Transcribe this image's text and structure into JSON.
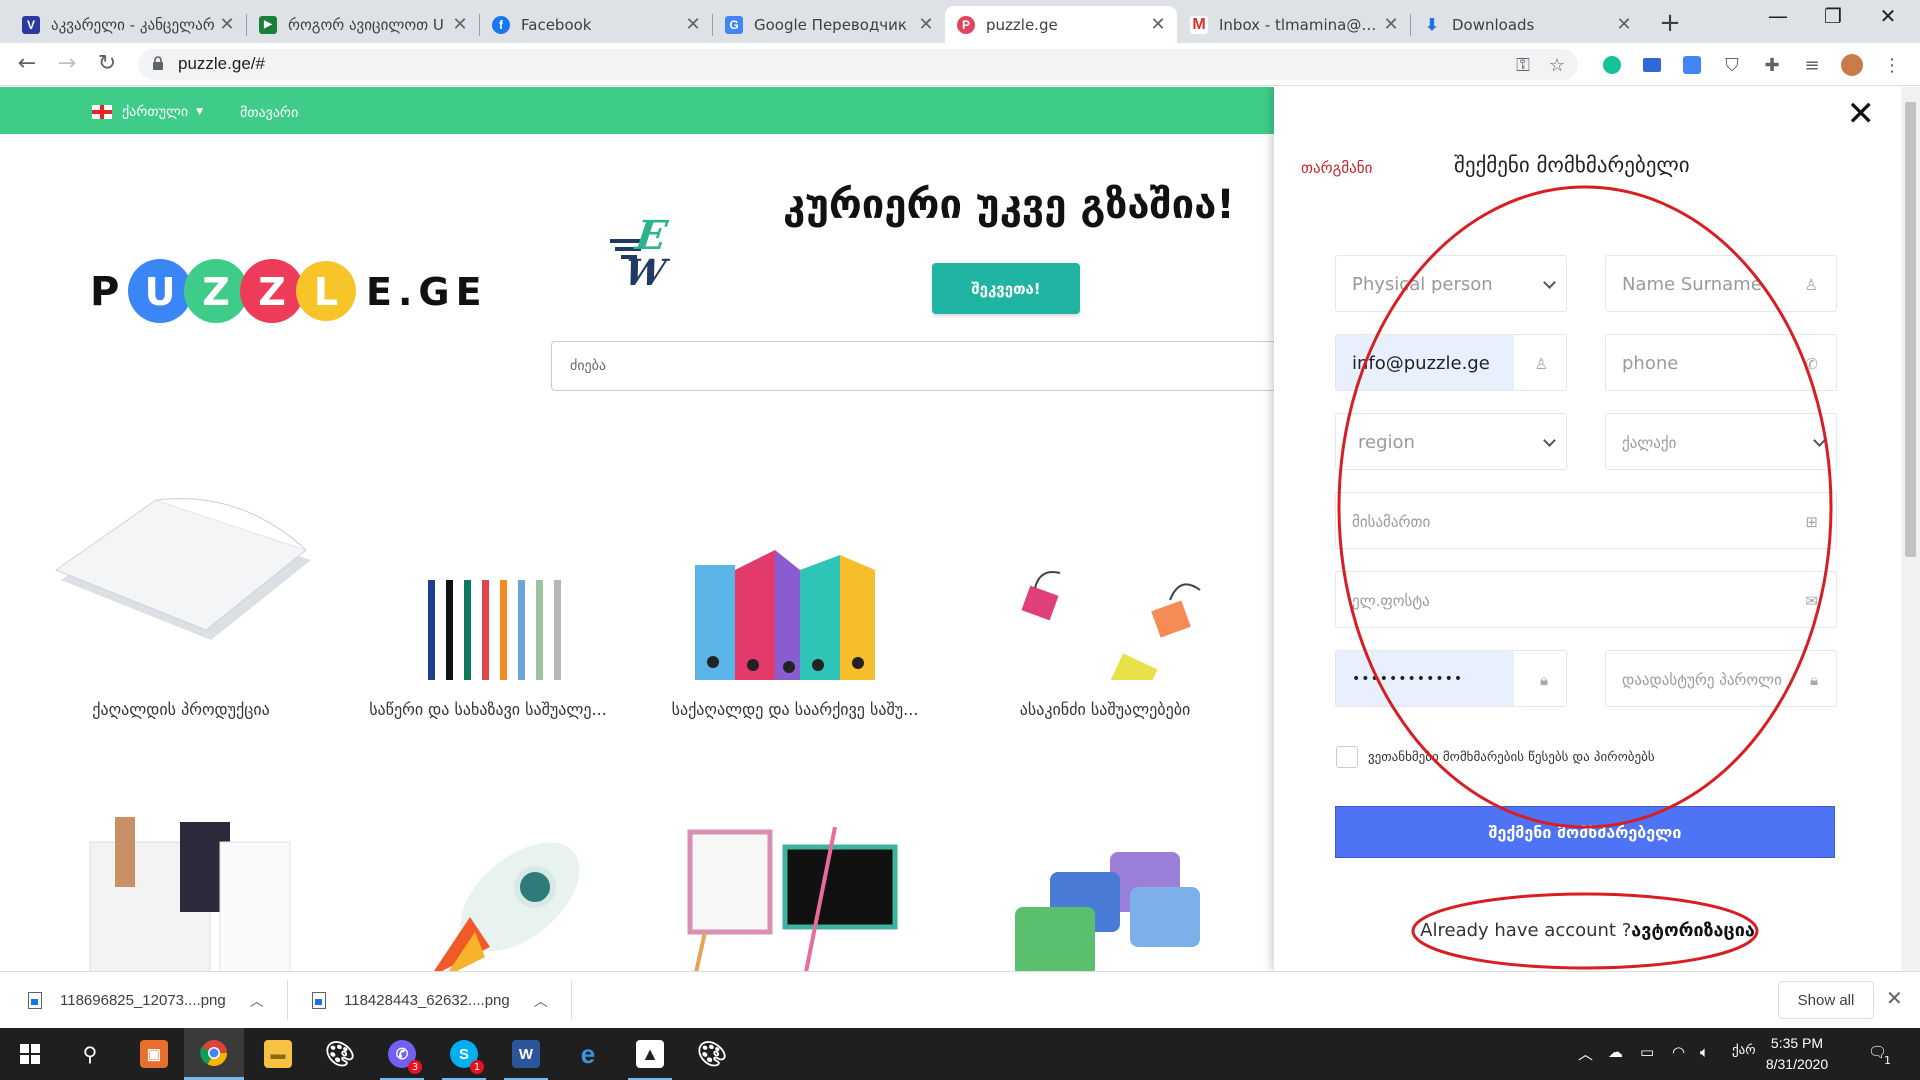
{
  "browser": {
    "tabs": [
      {
        "title": "აკვარელი - კანცელარ",
        "favicon": "V",
        "color": "#2b3aa0"
      },
      {
        "title": "როგორ ავიცილოთ U",
        "favicon": "▶",
        "color": "#188038"
      },
      {
        "title": "Facebook",
        "favicon": "f",
        "color": "#1877f2"
      },
      {
        "title": "Google Переводчик",
        "favicon": "G",
        "color": "#4285f4"
      },
      {
        "title": "puzzle.ge",
        "favicon": "P",
        "color": "#e2445c"
      },
      {
        "title": "Inbox - tlmamina@gm",
        "favicon": "M",
        "color": "#d93025"
      },
      {
        "title": "Downloads",
        "favicon": "⬇",
        "color": "#1a73e8"
      }
    ],
    "active_tab": 4,
    "url": "puzzle.ge/#"
  },
  "site": {
    "lang_label": "ქართული",
    "menu_home": "მთავარი",
    "logo_text_left": "P",
    "logo_letters": [
      "U",
      "Z",
      "Z",
      "L"
    ],
    "logo_text_right": "E.GE",
    "banner_brand": "Easy Way",
    "banner_title": "კურიერი უკვე გზაშია!",
    "banner_button": "შეკვეთა!",
    "search_placeholder": "ძიება",
    "categories": [
      "ქაღალდის პროდუქცია",
      "საწერი და სახაზავი საშუალე...",
      "საქაღალდე და საარქივე საშუ...",
      "ასაკინძი საშუალებები"
    ]
  },
  "modal": {
    "translate_link": "თარგმანი",
    "title": "შექმენი მომხმარებელი",
    "person_type": "Physical person",
    "name_placeholder": "Name Surname",
    "email_value": "info@puzzle.ge",
    "phone_placeholder": "phone",
    "region_placeholder": "region",
    "city_placeholder": "ქალაქი",
    "address_placeholder": "მისამართი",
    "email_placeholder": "ელ.ფოსტა",
    "password_value": "••••••••••••",
    "confirm_placeholder": "დაადასტურე პაროლი",
    "terms_label": "ვეთანხმები მომხმარების წესებს და პირობებს",
    "create_button": "შექმენი მომხმარებელი",
    "have_account": "Already have account ?",
    "login_link": "ავტორიზაცია"
  },
  "downloads": {
    "items": [
      "118696825_12073....png",
      "118428443_62632....png"
    ],
    "show_all": "Show all"
  },
  "taskbar": {
    "time": "5:35 PM",
    "date": "8/31/2020",
    "lang": "ქარ",
    "badges": {
      "viber": "3",
      "skype": "1"
    },
    "notification_count": "1"
  },
  "colors": {
    "green": "#3fcc89",
    "teal": "#20b5a3",
    "blue_button": "#4e73f5",
    "annotation_red": "#d81e22",
    "translate_red": "#c9232b"
  }
}
